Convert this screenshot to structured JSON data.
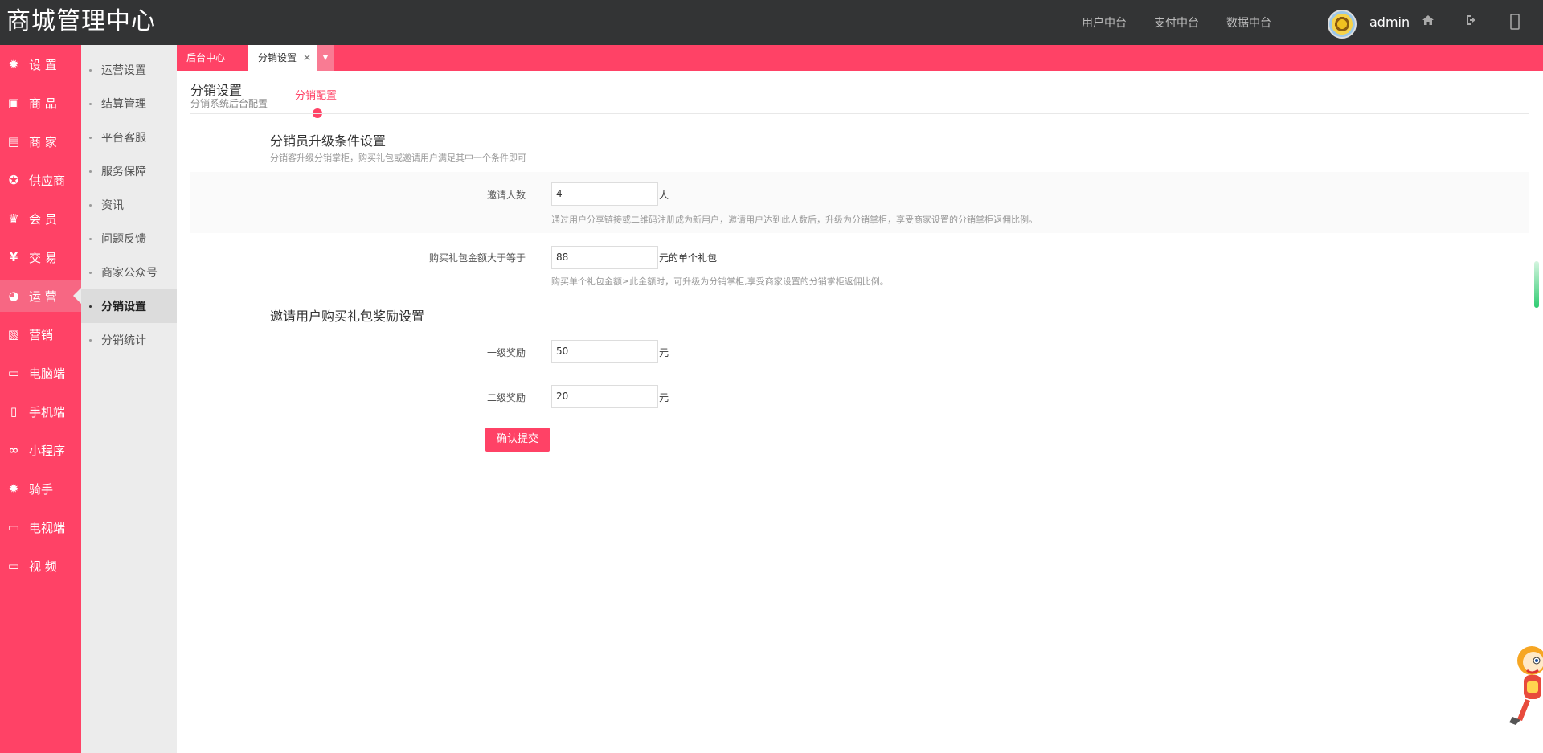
{
  "app": {
    "title": "商城管理中心"
  },
  "topnav": {
    "items": [
      "用户中台",
      "支付中台",
      "数据中台"
    ],
    "username": "admin"
  },
  "sidebar": {
    "items": [
      {
        "label": "设 置",
        "icon": "gear-icon"
      },
      {
        "label": "商 品",
        "icon": "bag-icon"
      },
      {
        "label": "商 家",
        "icon": "store-icon"
      },
      {
        "label": "供应商",
        "icon": "medal-icon"
      },
      {
        "label": "会 员",
        "icon": "crown-icon"
      },
      {
        "label": "交 易",
        "icon": "yen-icon"
      },
      {
        "label": "运 营",
        "icon": "pie-chart-icon",
        "active": true
      },
      {
        "label": "营销",
        "icon": "coupon-icon"
      },
      {
        "label": "电脑端",
        "icon": "monitor-icon"
      },
      {
        "label": "手机端",
        "icon": "phone-icon"
      },
      {
        "label": "小程序",
        "icon": "link-icon"
      },
      {
        "label": "骑手",
        "icon": "gear-icon"
      },
      {
        "label": "电视端",
        "icon": "monitor-icon"
      },
      {
        "label": "视 频",
        "icon": "monitor-icon"
      }
    ]
  },
  "subnav": {
    "items": [
      "运营设置",
      "结算管理",
      "平台客服",
      "服务保障",
      "资讯",
      "问题反馈",
      "商家公众号",
      "分销设置",
      "分销统计"
    ],
    "active": "分销设置"
  },
  "tabs": {
    "home": "后台中心",
    "current": "分销设置",
    "close": "✕",
    "dropdown": "▼"
  },
  "page": {
    "title": "分销设置",
    "subtitle": "分销系统后台配置",
    "tab": "分销配置"
  },
  "form": {
    "section1": {
      "title": "分销员升级条件设置",
      "desc": "分销客升级分销掌柜，购买礼包或邀请用户满足其中一个条件即可"
    },
    "invite_count": {
      "label": "邀请人数",
      "value": "4",
      "unit": "人",
      "hint": "通过用户分享链接或二维码注册成为新用户，邀请用户达到此人数后，升级为分销掌柜，享受商家设置的分销掌柜返佣比例。"
    },
    "gift_amount": {
      "label": "购买礼包金额大于等于",
      "value": "88",
      "unit": "元的单个礼包",
      "hint": "购买单个礼包金额≥此金额时，可升级为分销掌柜,享受商家设置的分销掌柜返佣比例。"
    },
    "section2": {
      "title": "邀请用户购买礼包奖励设置"
    },
    "level1": {
      "label": "一级奖励",
      "value": "50",
      "unit": "元"
    },
    "level2": {
      "label": "二级奖励",
      "value": "20",
      "unit": "元"
    },
    "submit": "确认提交"
  },
  "colors": {
    "accent": "#ff4266",
    "topbar": "#333435",
    "subnav_bg": "#ececec"
  }
}
